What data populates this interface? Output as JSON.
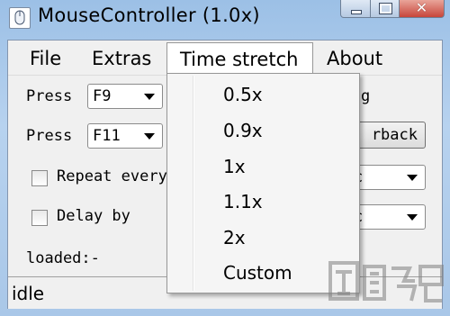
{
  "window": {
    "title": "MouseController (1.0x)"
  },
  "menubar": {
    "file": "File",
    "extras": "Extras",
    "time_stretch": "Time stretch",
    "about": "About"
  },
  "form": {
    "press1_label": "Press",
    "press1_key": "F9",
    "press2_label": "Press",
    "press2_key": "F11",
    "right_label1": "g",
    "playback_button": "rback",
    "repeat_label": "Repeat every",
    "delay_label": "Delay by",
    "combo3_fragment": "c",
    "combo4_fragment": "c",
    "loaded": "loaded:-"
  },
  "status": {
    "text": "idle"
  },
  "dropdown": {
    "items": [
      "0.5x",
      "0.9x",
      "1x",
      "1.1x",
      "2x",
      "Custom"
    ]
  },
  "colors": {
    "close_button": "#c7463a",
    "titlebar": "#a9c7e8"
  },
  "icons": {
    "app": "mouse-icon",
    "watermark": "watermark-logo"
  }
}
